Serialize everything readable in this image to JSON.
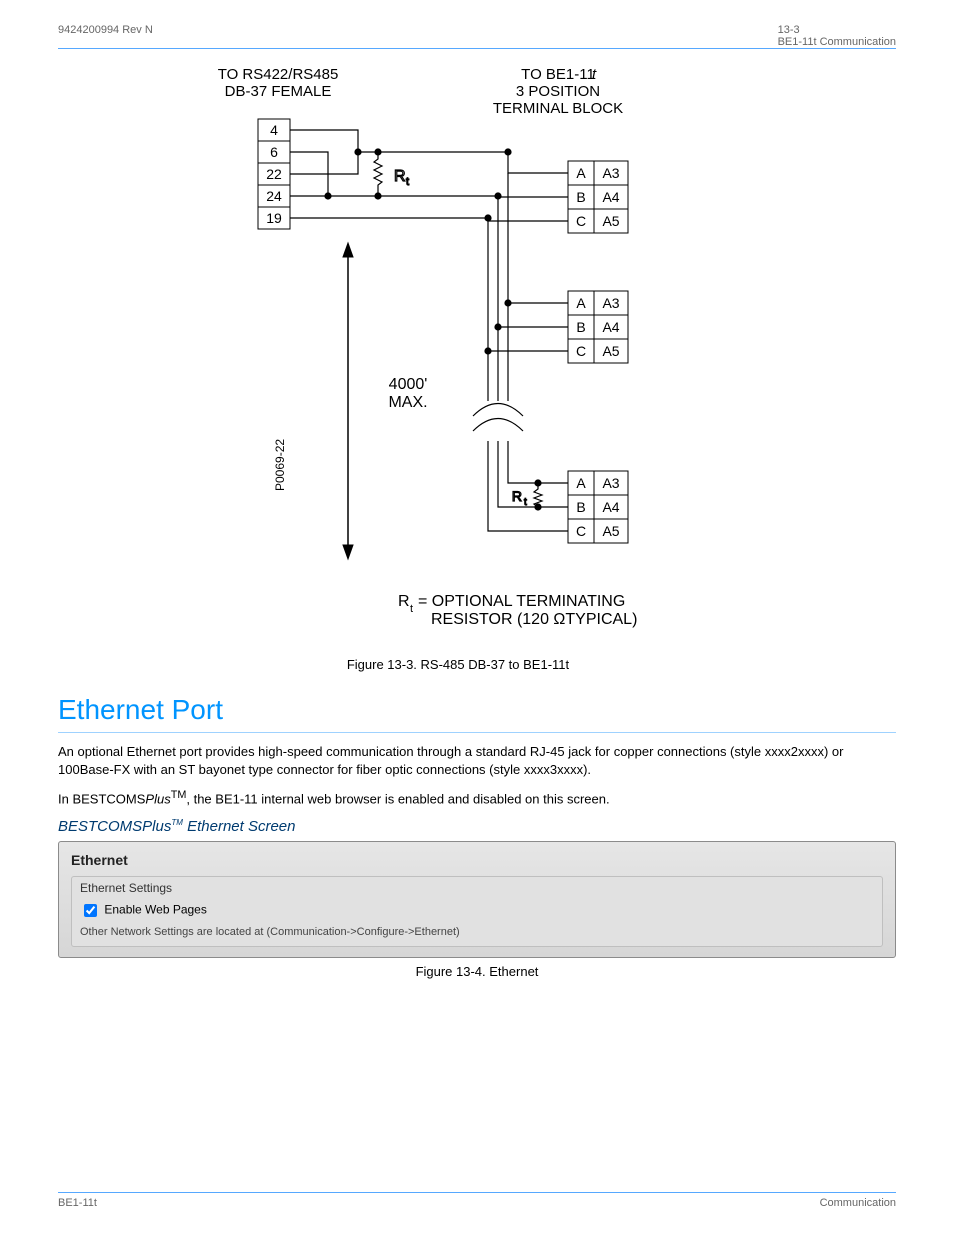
{
  "header": {
    "left_ref": "9424200994 Rev N",
    "right_title": "13-3",
    "right_sub": "BE1-11t Communication"
  },
  "diagram": {
    "left_block_title_line1": "TO RS422/RS485",
    "left_block_title_line2": "DB-37 FEMALE",
    "right_block_title_line1": "TO BE1-11",
    "right_block_title_line2": "3 POSITION",
    "right_block_title_line3": "TERMINAL BLOCK",
    "italic_t": "t",
    "left_pins": [
      "4",
      "6",
      "22",
      "24",
      "19"
    ],
    "terminal_letters": [
      "A",
      "B",
      "C"
    ],
    "terminal_codes_top": [
      "A3",
      "A4",
      "A5"
    ],
    "rt_label": "R",
    "rt_sub": "t",
    "distance_line1": "4000'",
    "distance_line2": "MAX.",
    "rotated_code": "P0069-22",
    "footnote_prefix": "R",
    "footnote_sub": "t",
    "footnote_line1_rest": "= OPTIONAL TERMINATING",
    "footnote_line2": "RESISTOR (120 ΩTYPICAL)",
    "caption": "Figure 13-3. RS-485 DB-37 to BE1-11t"
  },
  "ethernet": {
    "section_title": "Ethernet Port",
    "para1": "An optional Ethernet port provides high-speed communication through a standard RJ-45 jack for copper connections (style xxxx2xxxx) or 100Base-FX with an ST bayonet type connector for fiber optic connections (style xxxx3xxxx).",
    "para2_pre": "In BESTCOMS",
    "para2_tm": "Plus",
    "para2_post": ", the BE1-11 internal web browser is enabled and disabled on this screen.",
    "sub_heading_pre": "BESTCOMSPlus",
    "sub_heading_tm": "TM",
    "sub_heading_post": " Ethernet Screen",
    "panel_title": "Ethernet",
    "fieldset_legend": "Ethernet Settings",
    "checkbox_label": "Enable Web Pages",
    "checkbox_checked": true,
    "hint": "Other Network Settings are located at (Communication->Configure->Ethernet)",
    "panel_caption": "Figure 13-4. Ethernet"
  },
  "footer": {
    "left": "BE1-11t",
    "right": "Communication"
  }
}
